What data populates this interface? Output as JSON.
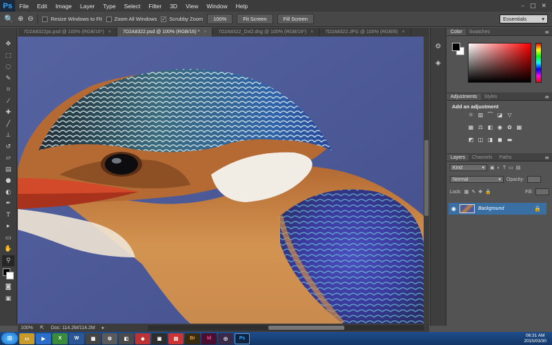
{
  "app": {
    "logo": "Ps"
  },
  "menu": [
    "File",
    "Edit",
    "Image",
    "Layer",
    "Type",
    "Select",
    "Filter",
    "3D",
    "View",
    "Window",
    "Help"
  ],
  "window_controls": [
    "–",
    "□",
    "✕"
  ],
  "options": {
    "resize_windows": "Resize Windows to Fit",
    "zoom_all": "Zoom All Windows",
    "scrubby_zoom": "Scrubby Zoom",
    "btn_100": "100%",
    "btn_fit": "Fit Screen",
    "btn_fill": "Fill Screen",
    "workspace": "Essentials"
  },
  "tabs": [
    {
      "label": "7D2A8322ps.psd @ 100% (RGB/16*)"
    },
    {
      "label": "7D2A8322.psd @ 100% (RGB/16) *"
    },
    {
      "label": "7D2A8322_DxO.dng @ 100% (RGB/16*)"
    },
    {
      "label": "7D2A8322.JPG @ 100% (RGB/8)"
    }
  ],
  "status": {
    "zoom": "100%",
    "doc": "Doc: 114.2M/114.2M"
  },
  "panels": {
    "color_tab": "Color",
    "swatches_tab": "Swatches",
    "adjustments_tab": "Adjustments",
    "styles_tab": "Styles",
    "adjustment_title": "Add an adjustment",
    "layers_tab": "Layers",
    "channels_tab": "Channels",
    "paths_tab": "Paths",
    "kind": "Kind",
    "blend": "Normal",
    "opacity_label": "Opacity:",
    "lock_label": "Lock:",
    "fill_label": "Fill:",
    "layer_name": "Background"
  },
  "taskbar": {
    "apps": [
      {
        "label": "W",
        "color": "#2b5797"
      },
      {
        "label": "Br",
        "color": "#3a2a0e"
      },
      {
        "label": "Id",
        "color": "#4a0e2e"
      },
      {
        "label": "Ps",
        "color": "#0d2340"
      }
    ],
    "time": "06:31 AM",
    "date": "2015/03/30"
  }
}
